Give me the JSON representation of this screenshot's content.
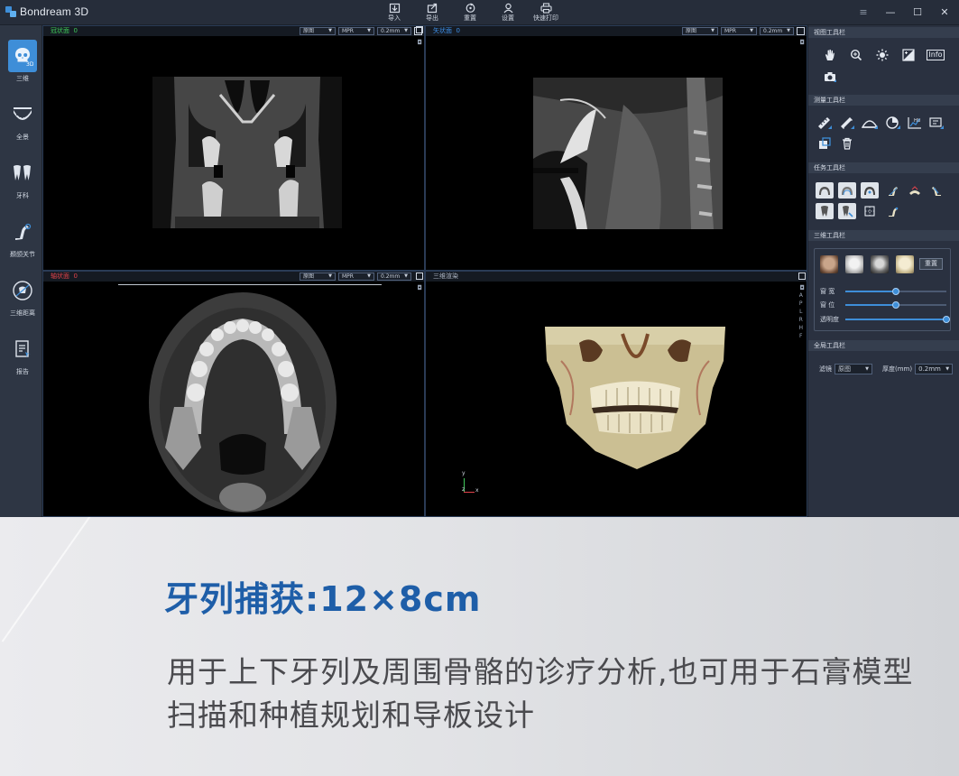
{
  "app": {
    "title": "Bondream 3D"
  },
  "toolbar": [
    {
      "label": "导入",
      "icon": "import-icon"
    },
    {
      "label": "导出",
      "icon": "export-icon"
    },
    {
      "label": "重置",
      "icon": "reset-icon"
    },
    {
      "label": "设置",
      "icon": "settings-icon"
    },
    {
      "label": "快速打印",
      "icon": "print-icon"
    }
  ],
  "window": {
    "menu": "≡",
    "minimize": "—",
    "maximize": "☐",
    "close": "✕"
  },
  "nav": [
    {
      "label": "三维",
      "icon": "skull-3d-icon",
      "active": true
    },
    {
      "label": "全景",
      "icon": "panorama-arch-icon",
      "active": false
    },
    {
      "label": "牙科",
      "icon": "tooth-icon",
      "active": false
    },
    {
      "label": "颞颌关节",
      "icon": "tmj-joint-icon",
      "active": false
    },
    {
      "label": "三维距离",
      "icon": "distance-3d-icon",
      "active": false
    },
    {
      "label": "报告",
      "icon": "report-icon",
      "active": false
    }
  ],
  "viewports": {
    "coronal": {
      "title": "冠状面",
      "index": "0",
      "color": "#3fc95a",
      "filter": "原图",
      "mode": "MPR",
      "thickness": "0.2mm"
    },
    "sagittal": {
      "title": "矢状面",
      "index": "0",
      "color": "#3d8ee6",
      "filter": "原图",
      "mode": "MPR",
      "thickness": "0.2mm"
    },
    "axial": {
      "title": "轴状面",
      "index": "0",
      "color": "#e0434b",
      "filter": "原图",
      "mode": "MPR",
      "thickness": "0.2mm"
    },
    "render3d": {
      "title": "三维渲染"
    }
  },
  "orientation_labels": [
    "A",
    "P",
    "L",
    "R",
    "H",
    "F"
  ],
  "axis_labels": {
    "y": "y",
    "z": "z",
    "x": "x"
  },
  "panel": {
    "view_tools": {
      "title": "视图工具栏",
      "icons": [
        "hand-pan-icon",
        "zoom-icon",
        "brightness-icon",
        "contrast-icon",
        "info-icon",
        "camera-icon"
      ],
      "info_text": "Info"
    },
    "measure_tools": {
      "title": "测量工具栏",
      "icons": [
        "ruler-icon",
        "multi-ruler-icon",
        "angle-icon",
        "area-icon",
        "hu-histogram-icon",
        "roi-icon",
        "export-measure-icon",
        "trash-icon"
      ],
      "hu_text": "HU"
    },
    "task_tools": {
      "title": "任务工具栏",
      "icons": [
        "arch-upper-icon",
        "arch-lower-icon",
        "arch-full-icon",
        "nerve-left-icon",
        "nerve-mid-icon",
        "nerve-right-icon",
        "implant-icon",
        "tooth-marker-icon",
        "crop-box-icon",
        "jaw-icon"
      ]
    },
    "render_tools": {
      "title": "三维工具栏",
      "presets": [
        "skin-preset-icon",
        "bone-preset-icon",
        "dark-bone-preset-icon",
        "teeth-preset-icon"
      ],
      "reset": "重置",
      "sliders": [
        {
          "label": "窗 宽",
          "value": 0.5
        },
        {
          "label": "窗 位",
          "value": 0.5
        },
        {
          "label": "透明度",
          "value": 1.0
        }
      ]
    },
    "global_tools": {
      "title": "全局工具栏",
      "filter_label": "滤镜",
      "filter_value": "原图",
      "thickness_label": "厚度(mm)",
      "thickness_value": "0.2mm"
    }
  },
  "promo": {
    "title": "牙列捕获:12×8cm",
    "description": "用于上下牙列及周围骨骼的诊疗分析,也可用于石膏模型扫描和种植规划和导板设计"
  },
  "colors": {
    "accent": "#3e8ed8",
    "promo_title": "#1e5ea8",
    "promo_text": "#4a4a4e"
  }
}
